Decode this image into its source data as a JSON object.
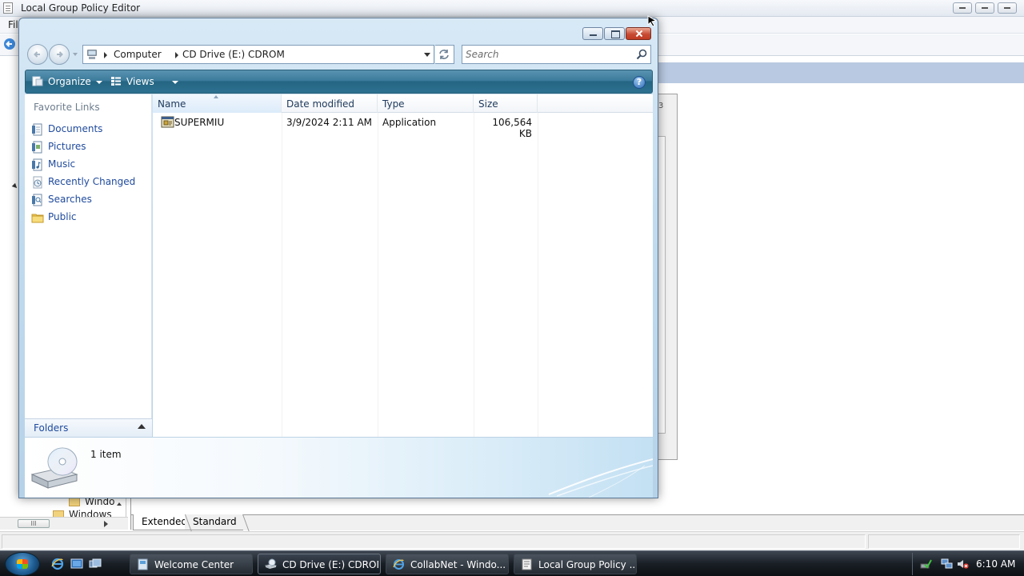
{
  "background_window": {
    "title": "Local Group Policy Editor",
    "menu_file": "Fil",
    "panel_number": "3",
    "tree_items": [
      "Windo",
      "Windows"
    ],
    "scroll_thumb": "III",
    "tabs": [
      "Extended",
      "Standard"
    ]
  },
  "explorer": {
    "breadcrumb": [
      "Computer",
      "CD Drive (E:) CDROM"
    ],
    "search": {
      "placeholder": "Search"
    },
    "commands": {
      "organize": "Organize",
      "views": "Views",
      "help": "?"
    },
    "favorites_header": "Favorite Links",
    "favorites": [
      {
        "label": "Documents",
        "icon": "documents-icon"
      },
      {
        "label": "Pictures",
        "icon": "pictures-icon"
      },
      {
        "label": "Music",
        "icon": "music-icon"
      },
      {
        "label": "Recently Changed",
        "icon": "recently-changed-icon"
      },
      {
        "label": "Searches",
        "icon": "searches-icon"
      },
      {
        "label": "Public",
        "icon": "public-folder-icon"
      }
    ],
    "folders_label": "Folders",
    "columns": [
      "Name",
      "Date modified",
      "Type",
      "Size"
    ],
    "files": [
      {
        "name": "SUPERMIU",
        "date_modified": "3/9/2024 2:11 AM",
        "type": "Application",
        "size": "106,564 KB",
        "icon": "application-icon"
      }
    ],
    "details": {
      "item_count": "1 item",
      "icon": "cd-drive-icon"
    }
  },
  "taskbar": {
    "quick_launch": [
      "ie-icon",
      "show-desktop-icon",
      "switch-windows-icon"
    ],
    "buttons": [
      {
        "label": "Welcome Center",
        "icon": "welcome-center-icon",
        "active": false
      },
      {
        "label": "CD Drive (E:) CDROM",
        "icon": "cd-drive-icon",
        "active": true
      },
      {
        "label": "CollabNet - Windo...",
        "icon": "ie-icon",
        "active": false
      },
      {
        "label": "Local Group Policy ...",
        "icon": "policy-editor-icon",
        "active": false
      }
    ],
    "tray_icons": [
      "safely-remove-icon",
      "network-icon",
      "volume-muted-icon"
    ],
    "clock": "6:10 AM"
  },
  "colors": {
    "command_bar": "#2d7190",
    "link_text": "#1f4a9c",
    "close_button": "#c74b34",
    "taskbar": "#1a1f26"
  }
}
